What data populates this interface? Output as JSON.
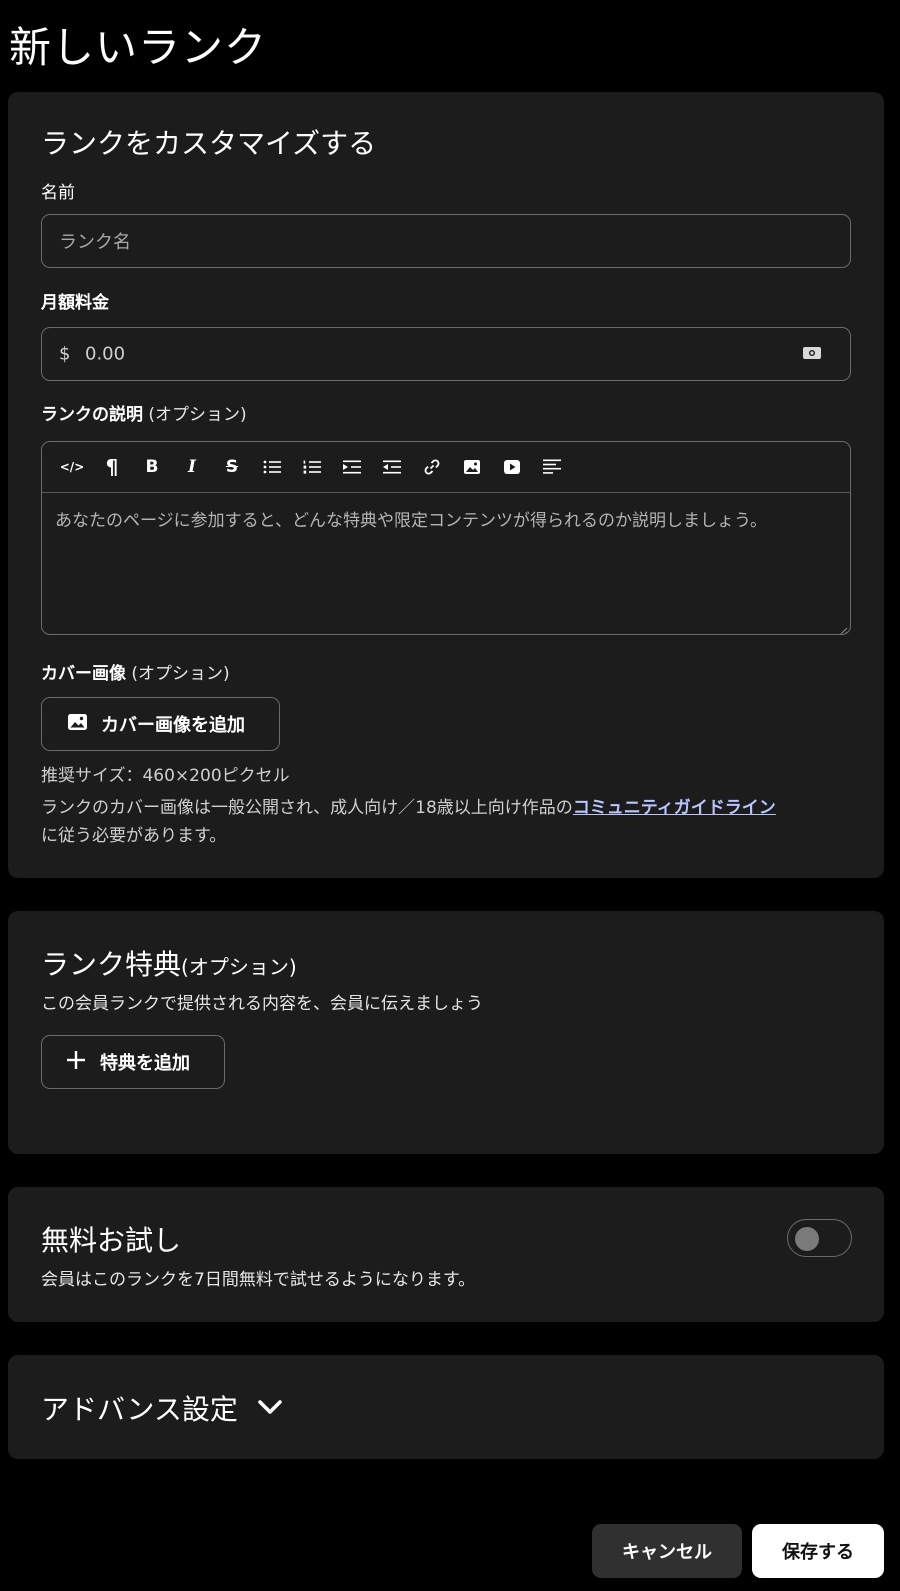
{
  "page": {
    "title": "新しいランク"
  },
  "customize": {
    "heading": "ランクをカスタマイズする",
    "name_label": "名前",
    "name_placeholder": "ランク名",
    "price_label": "月額料金",
    "currency_symbol": "$",
    "price_placeholder": "0.00",
    "currency_icon": "cash-icon",
    "description_label": "ランクの説明",
    "description_optional": "(オプション)",
    "toolbar": [
      {
        "name": "code-icon",
        "glyph": "</>"
      },
      {
        "name": "paragraph-icon",
        "glyph": "¶"
      },
      {
        "name": "bold-icon",
        "glyph": "B"
      },
      {
        "name": "italic-icon",
        "glyph": "I"
      },
      {
        "name": "strikethrough-icon",
        "glyph": "S"
      },
      {
        "name": "bulleted-list-icon",
        "glyph": ""
      },
      {
        "name": "numbered-list-icon",
        "glyph": ""
      },
      {
        "name": "indent-icon",
        "glyph": ""
      },
      {
        "name": "outdent-icon",
        "glyph": ""
      },
      {
        "name": "link-icon",
        "glyph": ""
      },
      {
        "name": "image-icon",
        "glyph": ""
      },
      {
        "name": "video-icon",
        "glyph": ""
      },
      {
        "name": "align-left-icon",
        "glyph": ""
      }
    ],
    "description_placeholder": "あなたのページに参加すると、どんな特典や限定コンテンツが得られるのか説明しましょう。",
    "cover_label": "カバー画像",
    "cover_optional": "(オプション)",
    "cover_button": "カバー画像を追加",
    "cover_size_hint": "推奨サイズ：460×200ピクセル",
    "cover_notice_before": "ランクのカバー画像は一般公開され、成人向け／18歳以上向け作品の",
    "cover_notice_link": "コミュニティガイドライン",
    "cover_notice_after": "に従う必要があります。"
  },
  "benefits": {
    "heading": "ランク特典",
    "optional": "(オプション)",
    "subtext": "この会員ランクで提供される内容を、会員に伝えましょう",
    "add_button": "特典を追加"
  },
  "trial": {
    "heading": "無料お試し",
    "subtext": "会員はこのランクを7日間無料で試せるようになります。",
    "enabled": false
  },
  "advanced": {
    "heading": "アドバンス設定"
  },
  "footer": {
    "cancel": "キャンセル",
    "save": "保存する"
  }
}
